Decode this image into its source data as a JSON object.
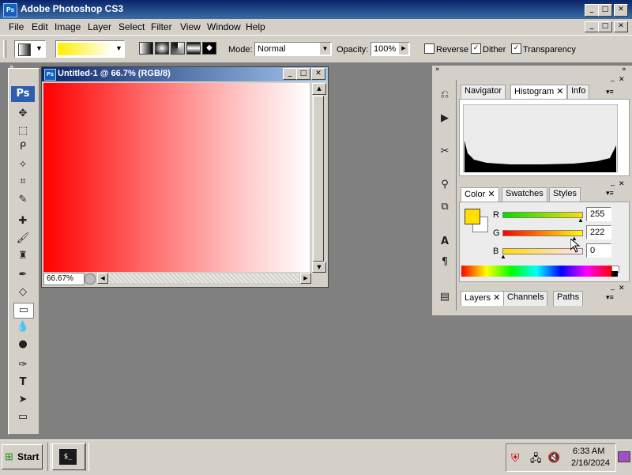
{
  "app": {
    "title": "Adobe Photoshop CS3",
    "icon_text": "Ps"
  },
  "menubar": {
    "items": [
      "File",
      "Edit",
      "Image",
      "Layer",
      "Select",
      "Filter",
      "View",
      "Window",
      "Help"
    ]
  },
  "options": {
    "mode_label": "Mode:",
    "mode_value": "Normal",
    "opacity_label": "Opacity:",
    "opacity_value": "100%",
    "reverse_label": "Reverse",
    "reverse_checked": false,
    "dither_label": "Dither",
    "dither_checked": true,
    "transparency_label": "Transparency",
    "transparency_checked": true,
    "gradient_colors": [
      "#ffee00",
      "#ffffff"
    ]
  },
  "toolbox": {
    "logo": "Ps"
  },
  "document": {
    "title": "Untitled-1 @ 66.7% (RGB/8)",
    "icon_text": "Ps",
    "zoom": "66.67%",
    "gradient_colors": [
      "#ff0000",
      "#ffffff"
    ]
  },
  "panels": {
    "group1_tabs": [
      "Navigator",
      "Histogram",
      "Info"
    ],
    "group1_active": "Histogram",
    "group2_tabs": [
      "Color",
      "Swatches",
      "Styles"
    ],
    "group2_active": "Color",
    "color": {
      "r_label": "R",
      "r_value": "255",
      "g_label": "G",
      "g_value": "222",
      "b_label": "B",
      "b_value": "0",
      "foreground": "#ffde00",
      "background": "#ffffff"
    },
    "group3_tabs": [
      "Layers",
      "Channels",
      "Paths"
    ],
    "group3_active": "Layers"
  },
  "taskbar": {
    "start_label": "Start",
    "time": "6:33 AM",
    "date": "2/16/2024",
    "task_icon_text": "$_"
  }
}
